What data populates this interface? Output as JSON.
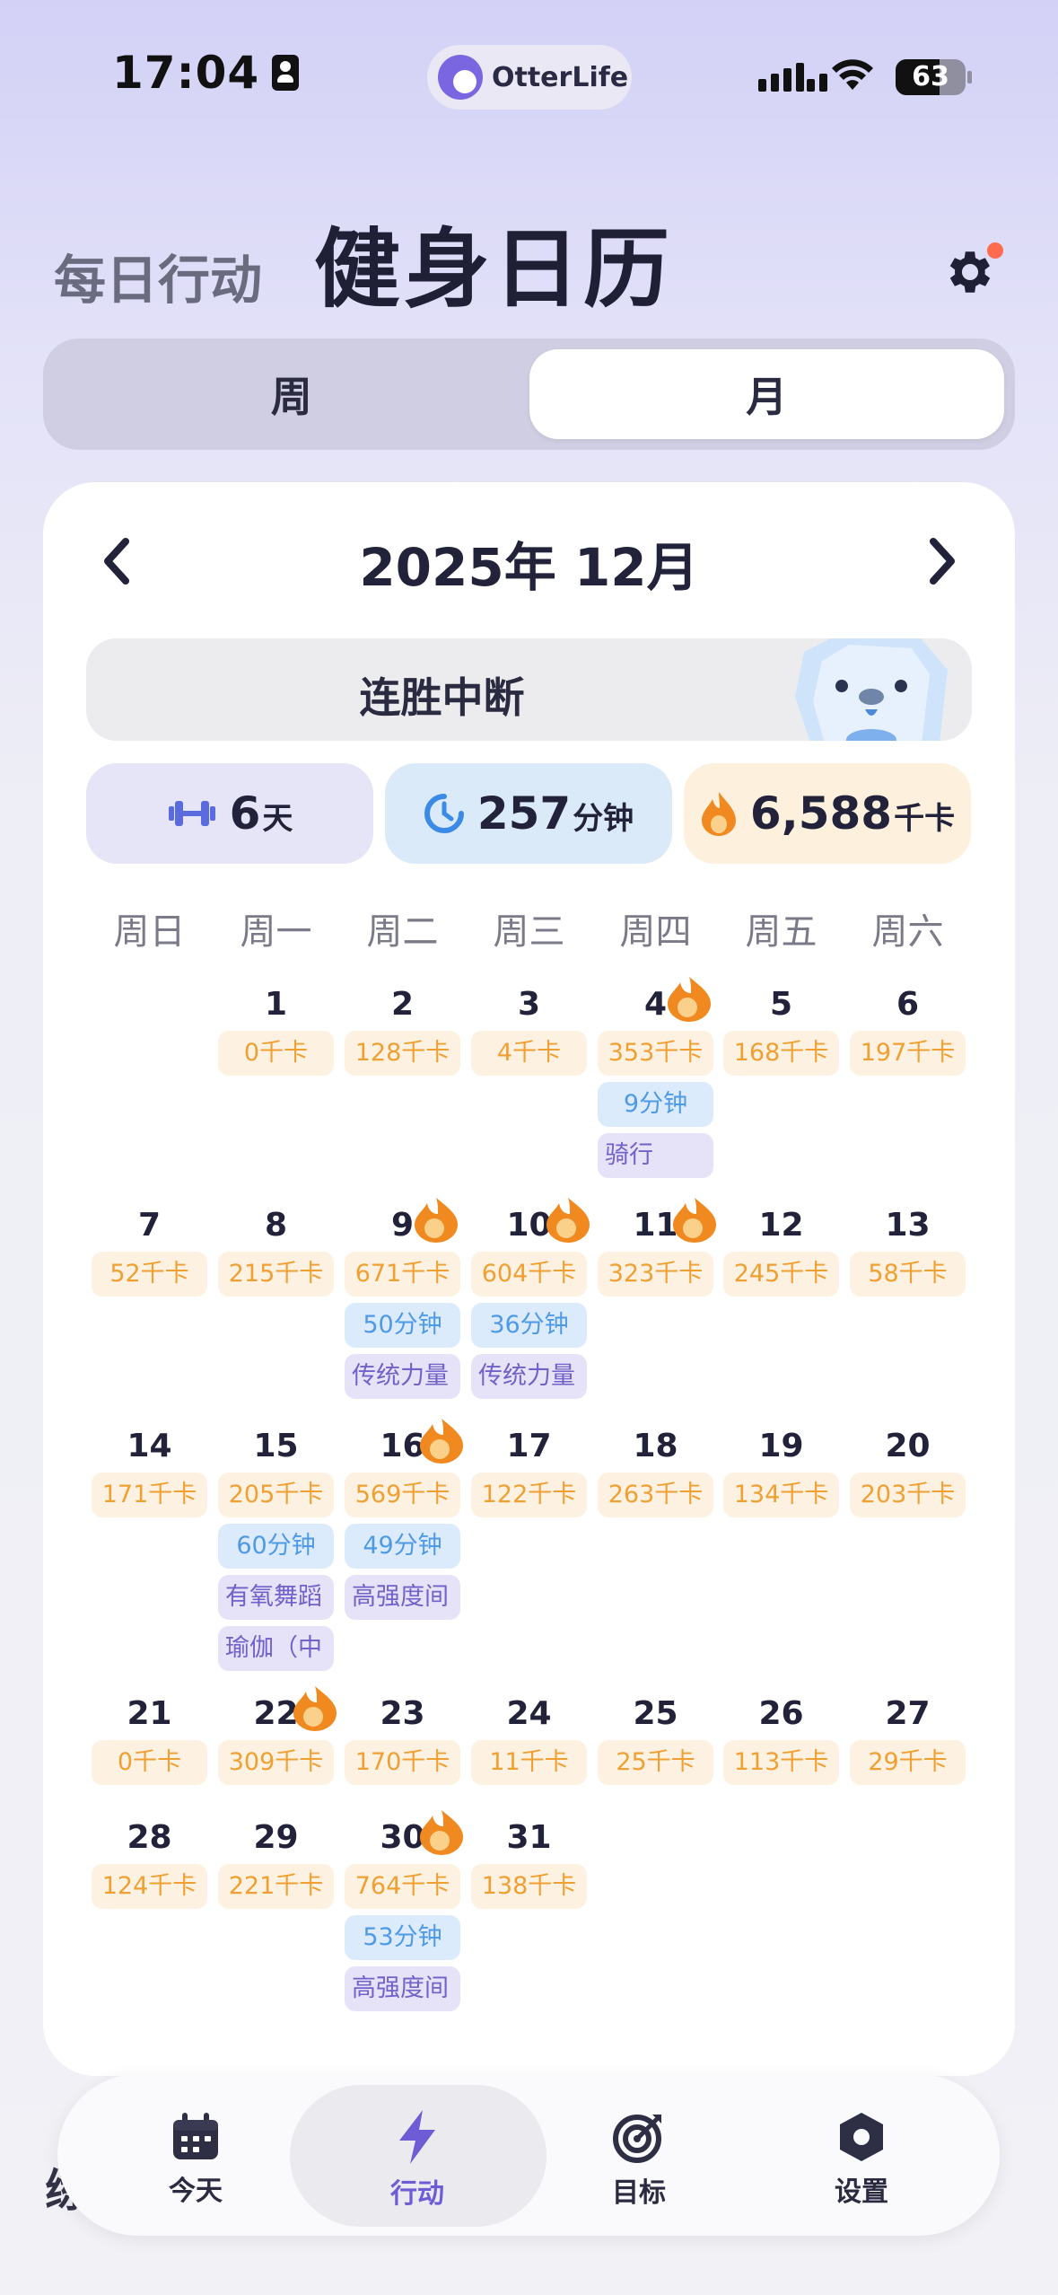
{
  "status": {
    "time": "17:04",
    "battery": "63",
    "battery_level": 0.63,
    "app_name": "OtterLife"
  },
  "header": {
    "subtitle": "每日行动",
    "title": "健身日历"
  },
  "segmented": {
    "week": "周",
    "month": "月",
    "selected": "月"
  },
  "calendar": {
    "month_title": "2025年 12月",
    "streak_label": "连胜中断",
    "stats": {
      "days_value": "6",
      "days_unit": "天",
      "minutes_value": "257",
      "minutes_unit": "分钟",
      "kcal_value": "6,588",
      "kcal_unit": "千卡"
    },
    "weekdays": [
      "周日",
      "周一",
      "周二",
      "周三",
      "周四",
      "周五",
      "周六"
    ],
    "days": [
      {
        "day": "1",
        "kcal": "0千卡"
      },
      {
        "day": "2",
        "kcal": "128千卡"
      },
      {
        "day": "3",
        "kcal": "4千卡"
      },
      {
        "day": "4",
        "kcal": "353千卡",
        "min": "9分钟",
        "acts": [
          "骑行"
        ],
        "flame": true
      },
      {
        "day": "5",
        "kcal": "168千卡"
      },
      {
        "day": "6",
        "kcal": "197千卡"
      },
      {
        "day": "7",
        "kcal": "52千卡"
      },
      {
        "day": "8",
        "kcal": "215千卡"
      },
      {
        "day": "9",
        "kcal": "671千卡",
        "min": "50分钟",
        "acts": [
          "传统力量"
        ],
        "flame": true
      },
      {
        "day": "10",
        "kcal": "604千卡",
        "min": "36分钟",
        "acts": [
          "传统力量"
        ],
        "flame": true
      },
      {
        "day": "11",
        "kcal": "323千卡",
        "flame": true
      },
      {
        "day": "12",
        "kcal": "245千卡"
      },
      {
        "day": "13",
        "kcal": "58千卡"
      },
      {
        "day": "14",
        "kcal": "171千卡"
      },
      {
        "day": "15",
        "kcal": "205千卡",
        "min": "60分钟",
        "acts": [
          "有氧舞蹈",
          "瑜伽（中"
        ]
      },
      {
        "day": "16",
        "kcal": "569千卡",
        "min": "49分钟",
        "acts": [
          "高强度间"
        ],
        "flame": true
      },
      {
        "day": "17",
        "kcal": "122千卡"
      },
      {
        "day": "18",
        "kcal": "263千卡"
      },
      {
        "day": "19",
        "kcal": "134千卡"
      },
      {
        "day": "20",
        "kcal": "203千卡"
      },
      {
        "day": "21",
        "kcal": "0千卡"
      },
      {
        "day": "22",
        "kcal": "309千卡",
        "flame": true
      },
      {
        "day": "23",
        "kcal": "170千卡"
      },
      {
        "day": "24",
        "kcal": "11千卡"
      },
      {
        "day": "25",
        "kcal": "25千卡"
      },
      {
        "day": "26",
        "kcal": "113千卡"
      },
      {
        "day": "27",
        "kcal": "29千卡"
      },
      {
        "day": "28",
        "kcal": "124千卡"
      },
      {
        "day": "29",
        "kcal": "221千卡"
      },
      {
        "day": "30",
        "kcal": "764千卡",
        "min": "53分钟",
        "acts": [
          "高强度间"
        ],
        "flame": true
      },
      {
        "day": "31",
        "kcal": "138千卡"
      }
    ]
  },
  "tabbar": {
    "items": [
      {
        "label": "今天",
        "icon": "calendar-icon"
      },
      {
        "label": "行动",
        "icon": "bolt-icon",
        "active": true
      },
      {
        "label": "目标",
        "icon": "target-icon"
      },
      {
        "label": "设置",
        "icon": "hexagon-settings-icon"
      }
    ]
  },
  "colors": {
    "accent": "#6d5cd6",
    "kcal": "#f0a032",
    "minutes": "#4f9ae6",
    "flame": "#f08a20"
  }
}
